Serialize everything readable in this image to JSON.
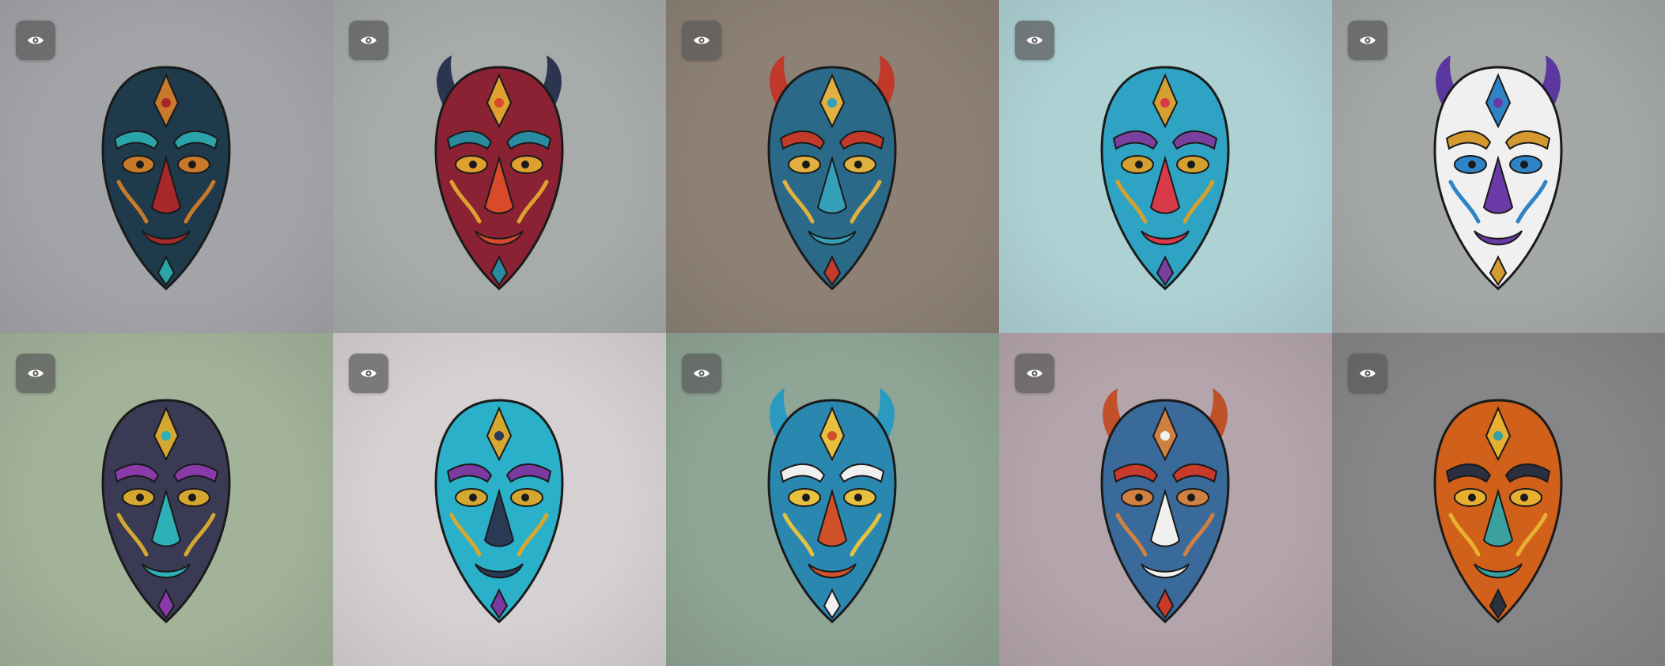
{
  "gallery": {
    "tiles": [
      {
        "bg": "#a2a4a7",
        "icon": "eye-icon",
        "mask": {
          "main": "#1f3a4a",
          "accent1": "#c87a2a",
          "accent2": "#2aa4a8",
          "accent3": "#a8282a",
          "horns": false,
          "hornColor": "#b33"
        }
      },
      {
        "bg": "#a7abaa",
        "icon": "eye-icon",
        "mask": {
          "main": "#8a2233",
          "accent1": "#e0a030",
          "accent2": "#2a8aa0",
          "accent3": "#d84a2a",
          "horns": true,
          "hornColor": "#2b3550"
        }
      },
      {
        "bg": "#8d8175",
        "icon": "eye-icon",
        "mask": {
          "main": "#2a6a88",
          "accent1": "#e0b040",
          "accent2": "#c23a2a",
          "accent3": "#34a0b8",
          "horns": true,
          "hornColor": "#c0392b"
        }
      },
      {
        "bg": "#aed1d4",
        "icon": "eye-icon",
        "mask": {
          "main": "#2fa3c3",
          "accent1": "#d4a030",
          "accent2": "#7b3fa0",
          "accent3": "#d83a4a",
          "horns": false,
          "hornColor": "#7b3fa0"
        }
      },
      {
        "bg": "#a3a7a6",
        "icon": "eye-icon",
        "mask": {
          "main": "#f0f0f0",
          "accent1": "#2f84c6",
          "accent2": "#d49a30",
          "accent3": "#6a3aa8",
          "horns": true,
          "hornColor": "#5b38a0"
        }
      },
      {
        "bg": "#a2b39a",
        "icon": "eye-icon",
        "mask": {
          "main": "#3a3a55",
          "accent1": "#d4a830",
          "accent2": "#8a3aa8",
          "accent3": "#2fb0b8",
          "horns": false,
          "hornColor": "#8a3aa8"
        }
      },
      {
        "bg": "#d5d0d1",
        "icon": "eye-icon",
        "mask": {
          "main": "#2ab0c8",
          "accent1": "#d4a830",
          "accent2": "#7a3aa0",
          "accent3": "#2a3a55",
          "horns": false,
          "hornColor": "#d4a830"
        }
      },
      {
        "bg": "#8fa595",
        "icon": "eye-icon",
        "mask": {
          "main": "#2a88b0",
          "accent1": "#e8c040",
          "accent2": "#f0f0f0",
          "accent3": "#d0502a",
          "horns": true,
          "hornColor": "#2a9ac0"
        }
      },
      {
        "bg": "#b4a5ac",
        "icon": "eye-icon",
        "mask": {
          "main": "#3a6a9a",
          "accent1": "#d08040",
          "accent2": "#c83a2a",
          "accent3": "#f0f0f0",
          "horns": true,
          "hornColor": "#c0502a"
        }
      },
      {
        "bg": "#868688",
        "icon": "eye-icon",
        "mask": {
          "main": "#d0601a",
          "accent1": "#e8b030",
          "accent2": "#2a3040",
          "accent3": "#3aa0a0",
          "horns": false,
          "hornColor": "#3a3a3a"
        }
      }
    ]
  }
}
